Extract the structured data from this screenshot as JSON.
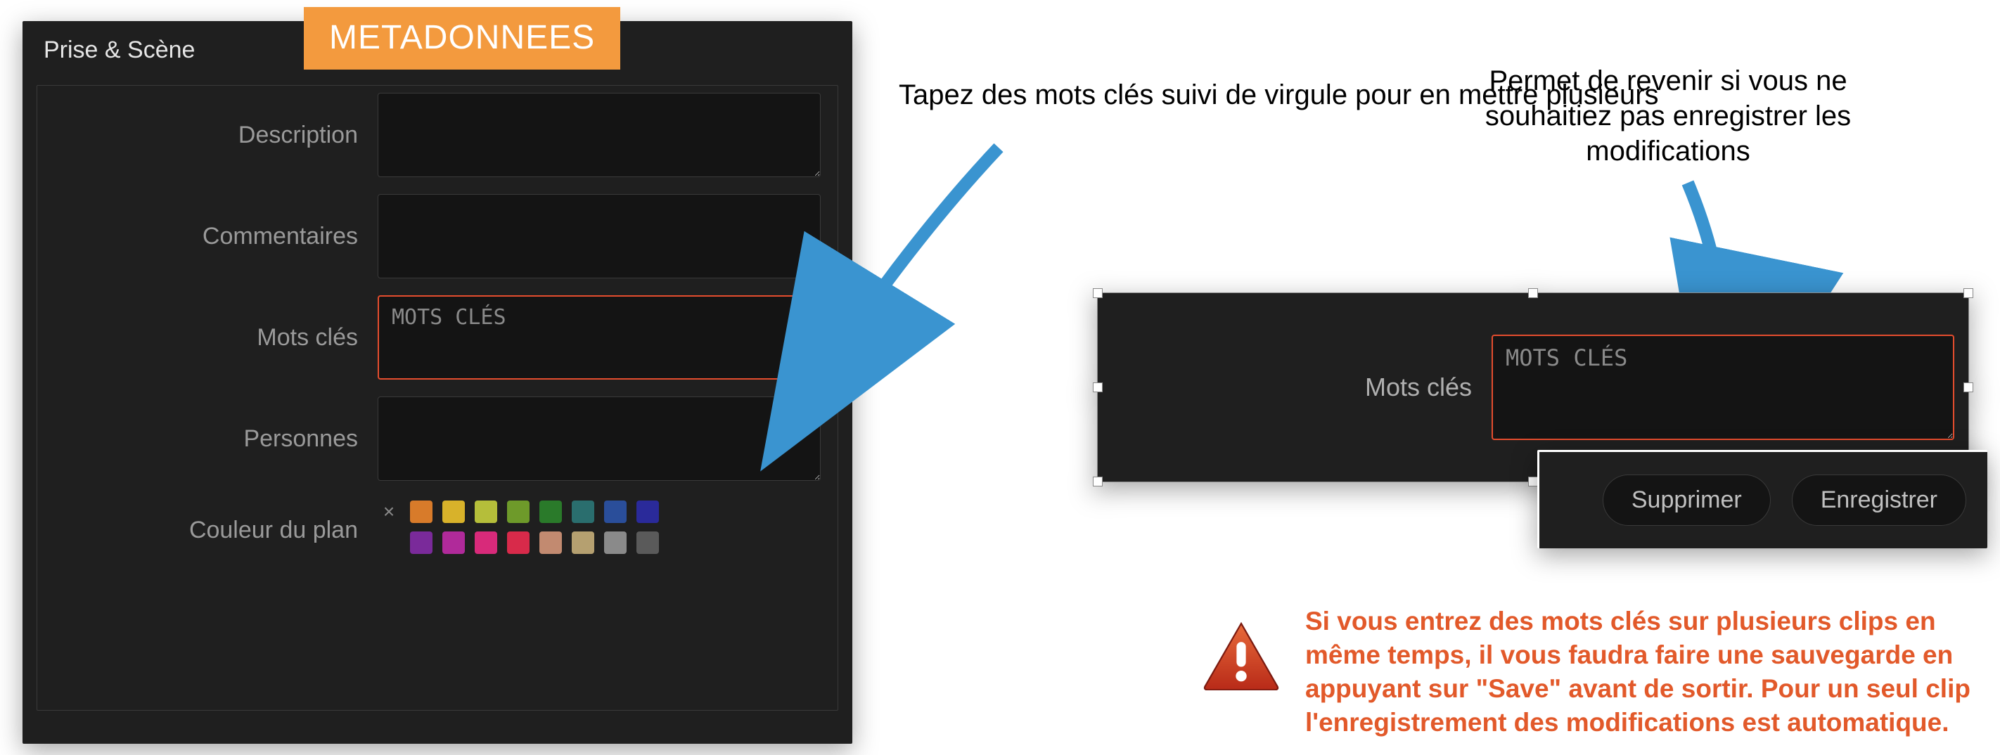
{
  "badge": {
    "label": "METADONNEES"
  },
  "panel": {
    "section_title": "Prise & Scène",
    "fields": {
      "description": {
        "label": "Description",
        "value": ""
      },
      "comments": {
        "label": "Commentaires",
        "value": ""
      },
      "keywords": {
        "label": "Mots clés",
        "value": "MOTS CLÉS"
      },
      "people": {
        "label": "Personnes",
        "value": ""
      },
      "clip_color": {
        "label": "Couleur du plan"
      }
    },
    "swatches_row1": [
      "#d87b2a",
      "#d8b22a",
      "#b5be3a",
      "#6e9a2a",
      "#2a7a2a",
      "#2a6e6e",
      "#2a4e9a",
      "#2a2a9a"
    ],
    "swatches_row2": [
      "#7a2a9a",
      "#b02a9a",
      "#d82a7a",
      "#d82a4a",
      "#c28a70",
      "#b5a070",
      "#8a8a8a",
      "#5a5a5a"
    ]
  },
  "annotations": {
    "left": "Tapez des mots clés suivi de virgule pour en mettre plusieurs",
    "right": "Permet de revenir si vous ne souhaitiez pas enregistrer les modifications"
  },
  "right_top": {
    "label": "Mots clés",
    "value": "MOTS CLÉS"
  },
  "buttons": {
    "delete": "Supprimer",
    "save": "Enregistrer"
  },
  "warning": "Si vous entrez des mots clés sur plusieurs clips en même temps, il vous faudra faire une sauvegarde en appuyant sur \"Save\" avant de sortir. Pour un seul clip l'enregistrement des modifications est automatique.",
  "colors": {
    "accent_orange": "#f39a3e",
    "field_active_border": "#e54d2e",
    "arrow_stroke": "#3a94d0",
    "arrow_fill": "#3a94d0",
    "warning_text": "#e2592a"
  }
}
